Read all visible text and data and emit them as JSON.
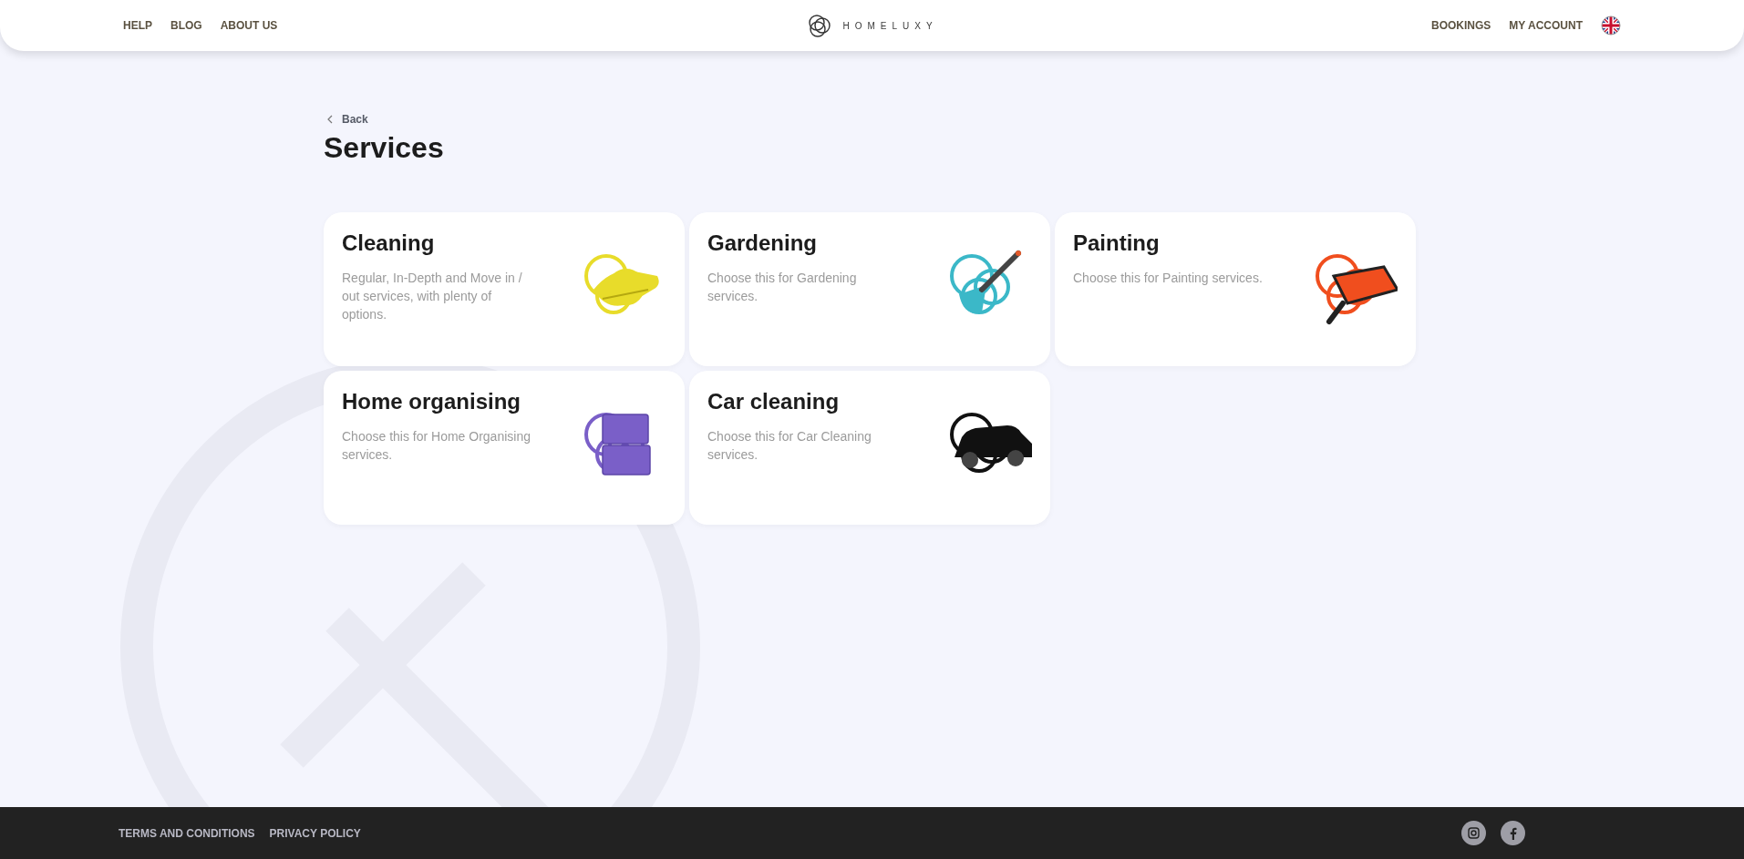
{
  "header": {
    "left_nav": [
      "HELP",
      "BLOG",
      "ABOUT US"
    ],
    "logo_text": "HOMELUXY",
    "right_nav": [
      "BOOKINGS",
      "MY ACCOUNT"
    ]
  },
  "back_link": "Back",
  "title": "Services",
  "services": [
    {
      "name": "Cleaning",
      "description": "Regular, In-Depth and Move in / out services, with plenty of options.",
      "color": "#e8dc2a",
      "kind": "gloves"
    },
    {
      "name": "Gardening",
      "description": "Choose this for Gardening services.",
      "color": "#3bb8c8",
      "kind": "trowel"
    },
    {
      "name": "Painting",
      "description": "Choose this for Painting services.",
      "color": "#f04e1e",
      "kind": "tray"
    },
    {
      "name": "Home organising",
      "description": "Choose this for Home Organising services.",
      "color": "#7a5fc8",
      "kind": "boxes"
    },
    {
      "name": "Car cleaning",
      "description": "Choose this for Car Cleaning services.",
      "color": "#111111",
      "kind": "car"
    }
  ],
  "footer": {
    "links": [
      "TERMS AND CONDITIONS",
      "PRIVACY POLICY"
    ]
  }
}
